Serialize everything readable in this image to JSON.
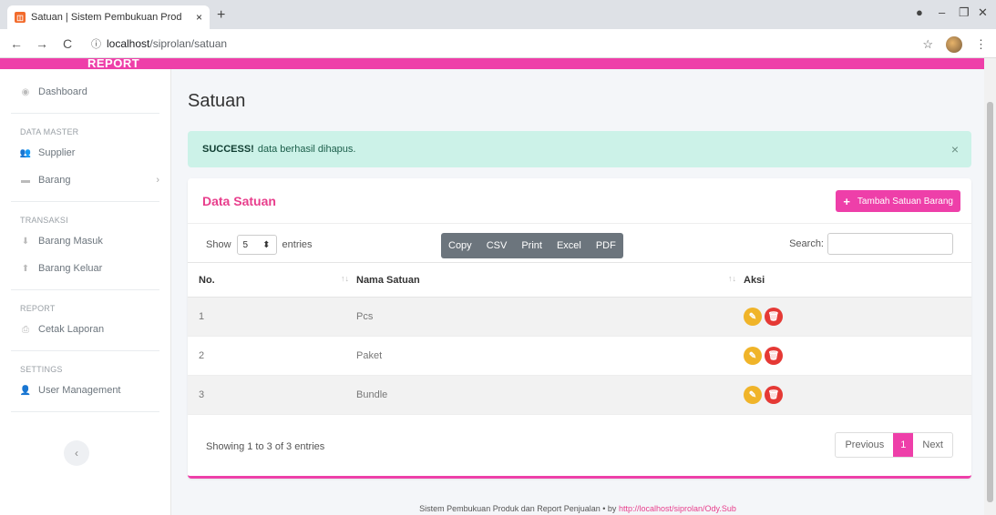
{
  "browser": {
    "tab_title": "Satuan | Sistem Pembukuan Prod",
    "tab_close": "×",
    "new_tab": "+",
    "url_host": "localhost",
    "url_path": "/siprolan/satuan"
  },
  "app": {
    "brand": "REPORT"
  },
  "sidebar": {
    "dashboard": "Dashboard",
    "section_master": "DATA MASTER",
    "supplier": "Supplier",
    "barang": "Barang",
    "section_transaksi": "TRANSAKSI",
    "barang_masuk": "Barang Masuk",
    "barang_keluar": "Barang Keluar",
    "section_report": "REPORT",
    "cetak_laporan": "Cetak Laporan",
    "section_settings": "SETTINGS",
    "user_management": "User Management"
  },
  "page": {
    "title": "Satuan"
  },
  "alert": {
    "strong": "SUCCESS!",
    "message": "data berhasil dihapus.",
    "close": "×"
  },
  "card": {
    "title": "Data Satuan",
    "add_button": "Tambah Satuan Barang"
  },
  "controls": {
    "show_label": "Show",
    "show_value": "5",
    "entries_label": "entries",
    "search_label": "Search:",
    "exports": [
      "Copy",
      "CSV",
      "Print",
      "Excel",
      "PDF"
    ]
  },
  "table": {
    "headers": [
      "No.",
      "Nama Satuan",
      "Aksi"
    ],
    "rows": [
      {
        "no": "1",
        "nama": "Pcs"
      },
      {
        "no": "2",
        "nama": "Paket"
      },
      {
        "no": "3",
        "nama": "Bundle"
      }
    ]
  },
  "pagination": {
    "info": "Showing 1 to 3 of 3 entries",
    "previous": "Previous",
    "current": "1",
    "next": "Next"
  },
  "footer": {
    "text": "Sistem Pembukuan Produk dan Report Penjualan • by ",
    "link": "http://localhost/siprolan/Ody.Sub"
  },
  "colors": {
    "accent": "#ee3fa9",
    "title_pink": "#e83e8c",
    "edit": "#f0b429",
    "delete": "#e53935",
    "alert_bg": "#ccf2e8"
  }
}
